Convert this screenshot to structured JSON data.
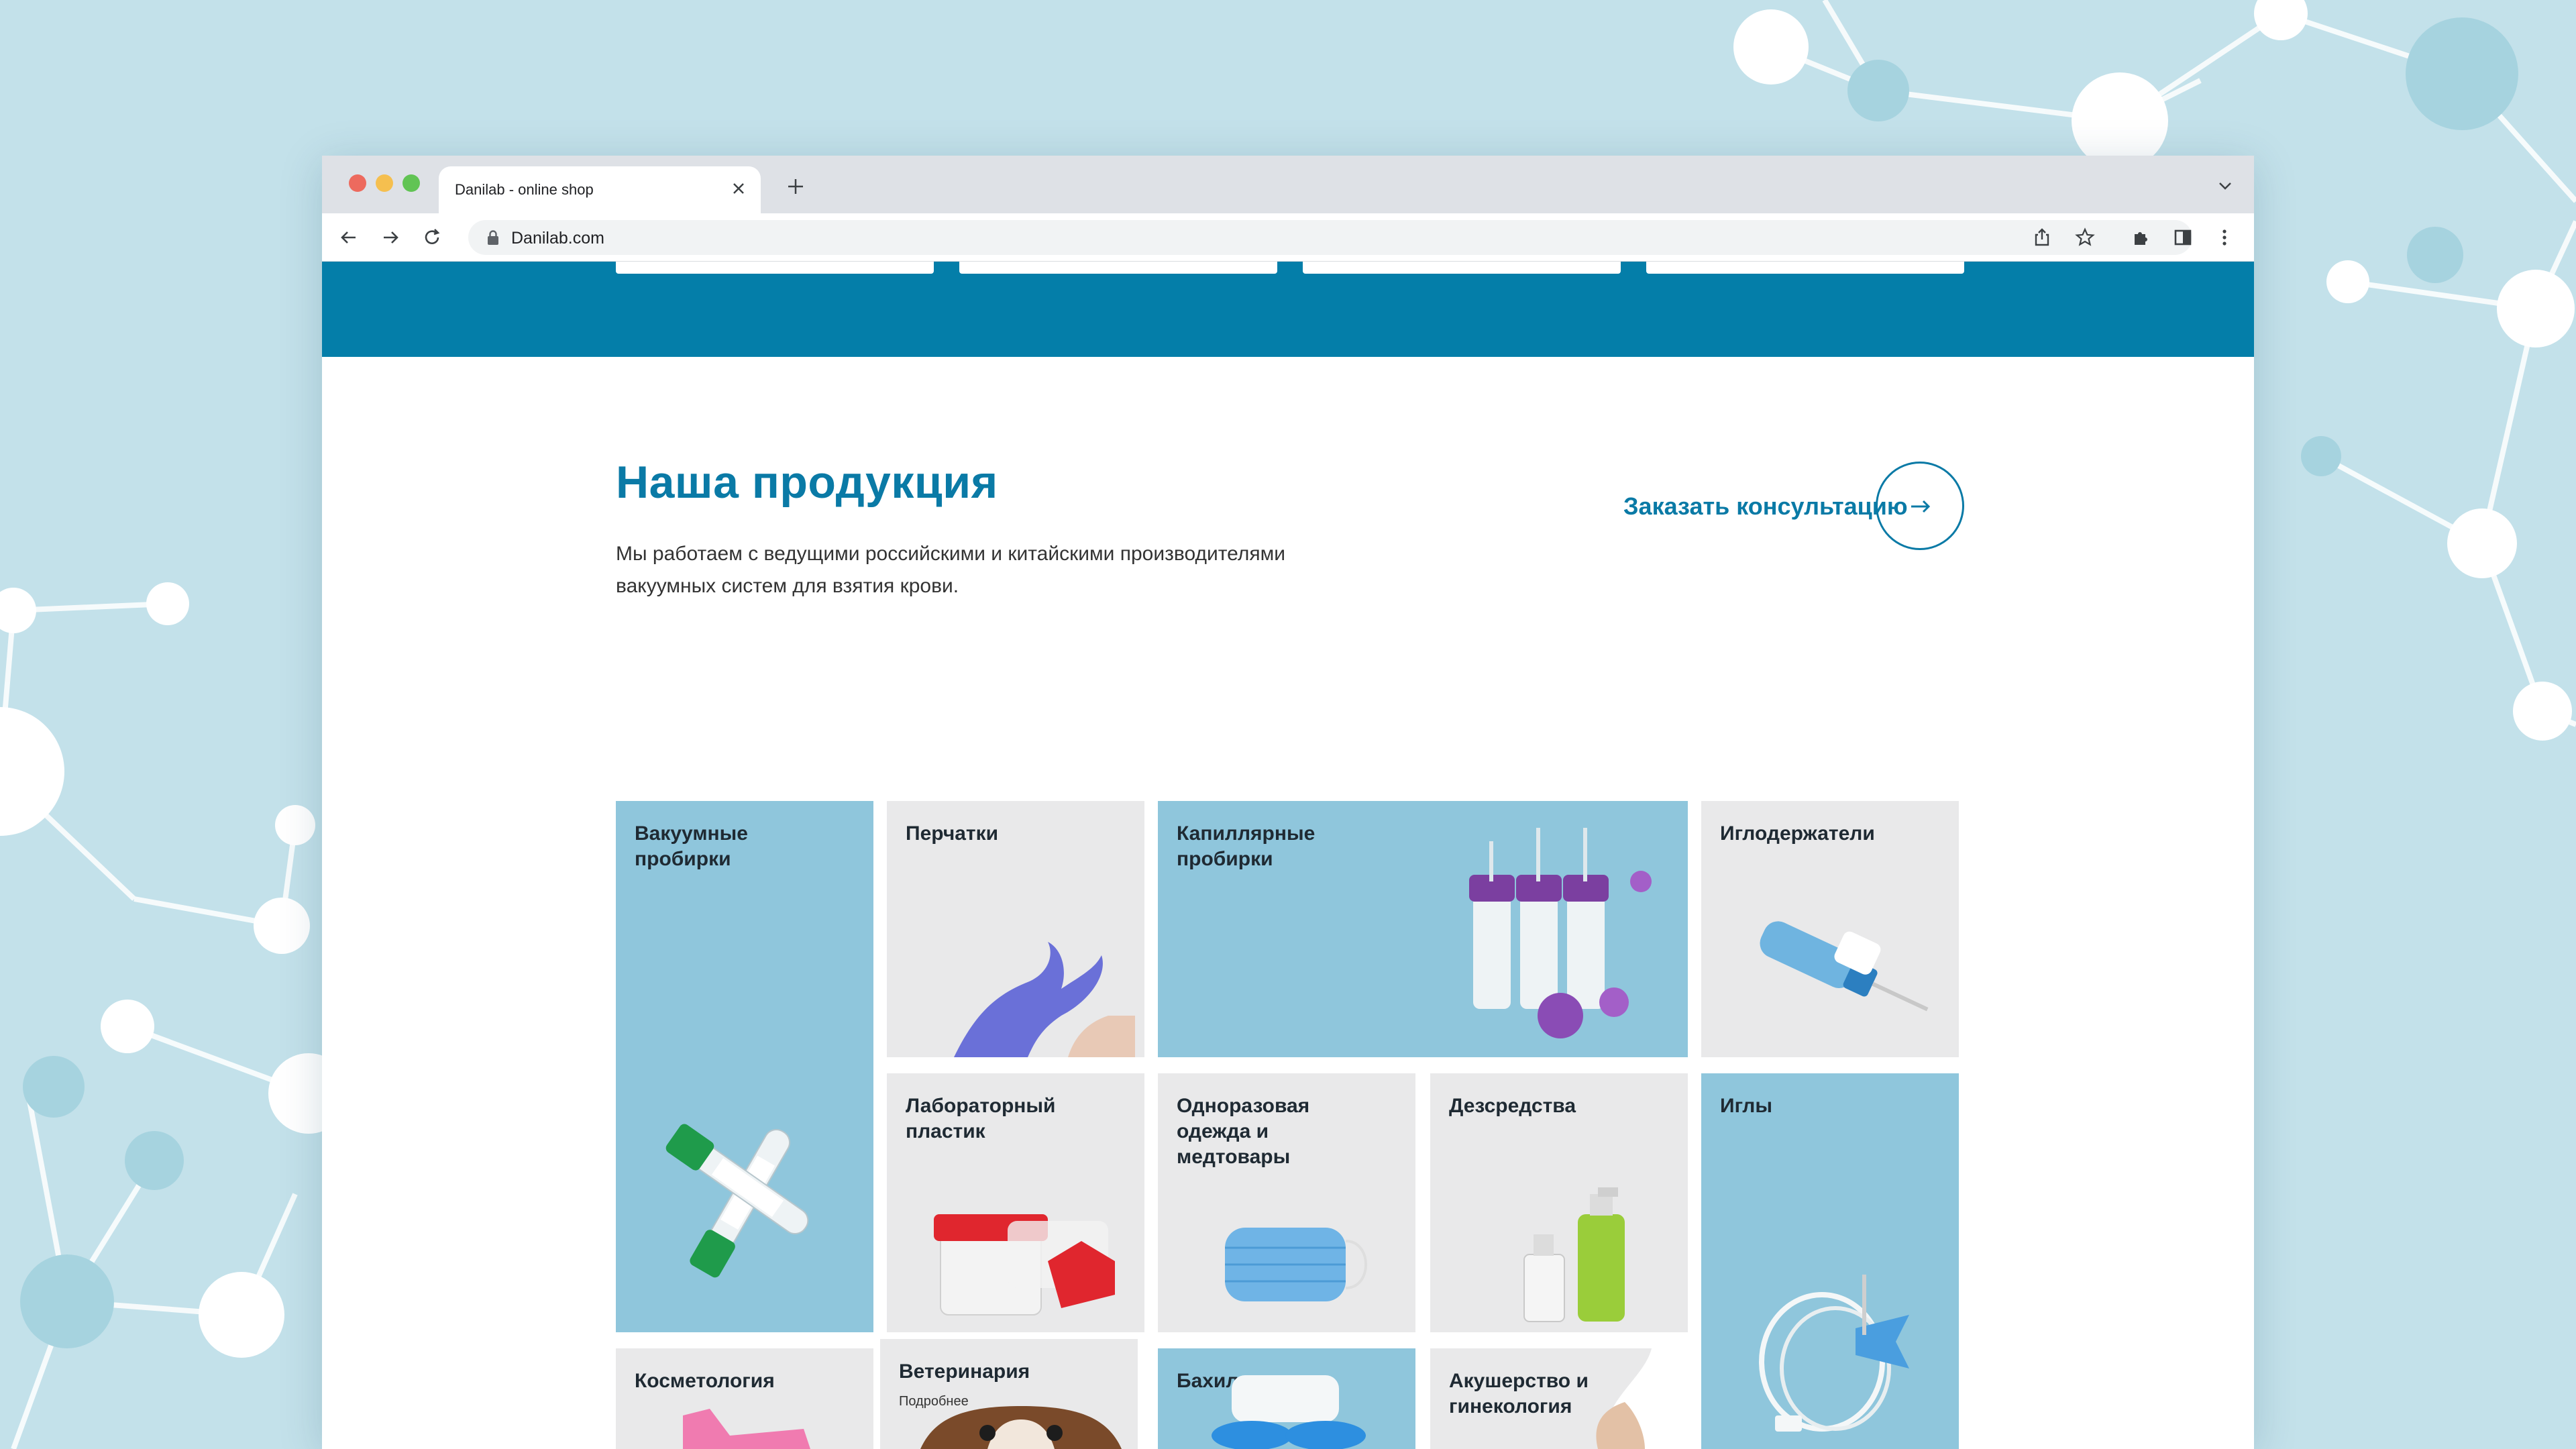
{
  "browser": {
    "tab_title": "Danilab - online shop",
    "url": "Danilab.com"
  },
  "page": {
    "section_title": "Наша продукция",
    "section_desc": "Мы работаем с ведущими российскими и китайскими производителями вакуумных систем для взятия крови.",
    "cta_label": "Заказать консультацию",
    "products": {
      "vacuum_tubes": "Вакуумные\nпробирки",
      "gloves": "Перчатки",
      "capillary_tubes": "Капиллярные\nпробирки",
      "needle_holders": "Иглодержатели",
      "lab_plastic": "Лабораторный\nпластик",
      "disposable_clothing": "Одноразовая\nодежда и\nмедтовары",
      "disinfectants": "Дезсредства",
      "needles": "Иглы",
      "cosmetology": "Косметология",
      "veterinary": "Ветеринария",
      "veterinary_more": "Подробнее",
      "shoe_covers": "Бахилы",
      "obstetrics": "Акушерство и\nгинекология"
    }
  },
  "colors": {
    "brand_blue": "#047ea9",
    "title_blue": "#0a7aa6",
    "tile_blue": "#8fc6dc",
    "tile_gray": "#e9e9ea"
  }
}
